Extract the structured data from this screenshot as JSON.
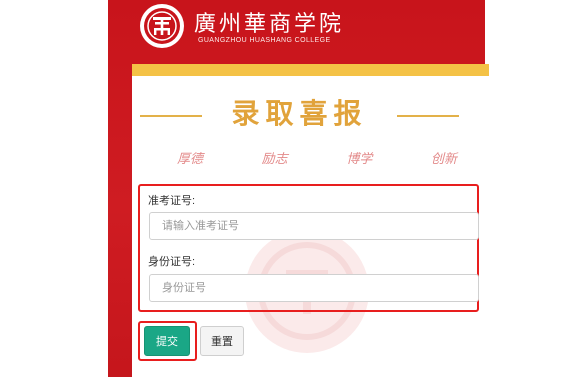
{
  "header": {
    "school_name": "廣州華商学院",
    "school_name_en": "GUANGZHOU HUASHANG COLLEGE"
  },
  "banner": {
    "title": "录取喜报"
  },
  "motto": [
    "厚德",
    "励志",
    "博学",
    "创新"
  ],
  "form": {
    "exam_id": {
      "label": "准考证号:",
      "placeholder": "请输入准考证号",
      "value": ""
    },
    "id_card": {
      "label": "身份证号:",
      "placeholder": "身份证号",
      "value": ""
    }
  },
  "buttons": {
    "submit_label": "提交",
    "reset_label": "重置"
  },
  "colors": {
    "brand_red": "#c8141b",
    "gold": "#f4c246",
    "submit_green": "#1aa786",
    "highlight_red": "#e81e1e"
  },
  "icons": {
    "logo": "college-seal-logo"
  }
}
